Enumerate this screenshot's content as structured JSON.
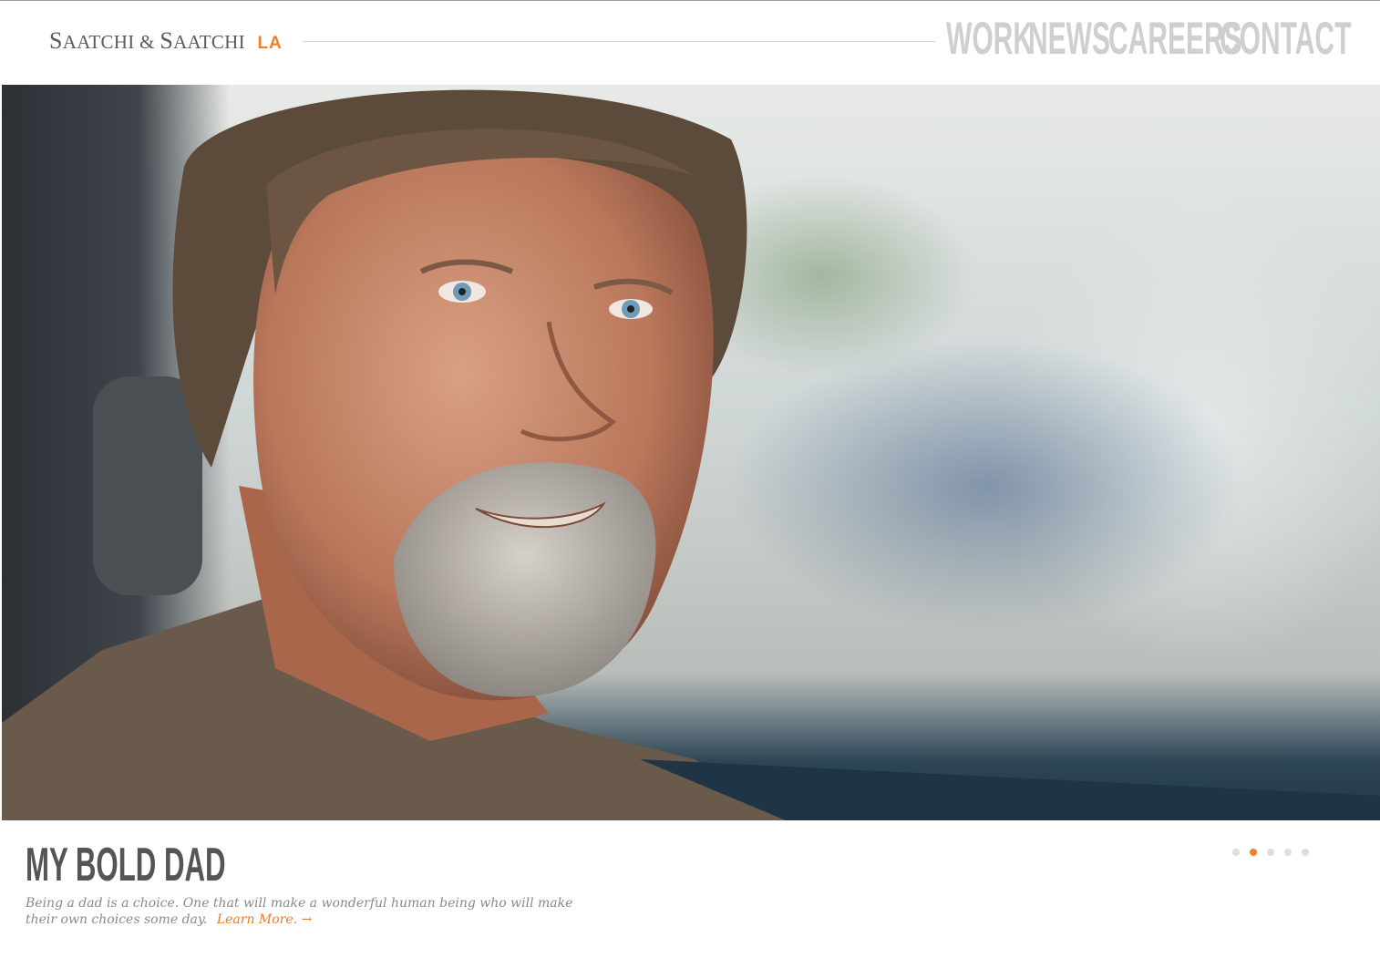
{
  "brand": {
    "name": "Saatchi & Saatchi",
    "name_caps_1": "S",
    "name_rest_1": "AATCHI",
    "name_amp": "&",
    "name_caps_2": "S",
    "name_rest_2": "AATCHI",
    "suffix": "LA",
    "accent_color": "#f07f2c"
  },
  "nav": {
    "items": [
      {
        "label": "WORK"
      },
      {
        "label": "NEWS"
      },
      {
        "label": "CAREERS"
      },
      {
        "label": "CONTACT"
      }
    ],
    "color": "#cfcfcf"
  },
  "hero": {
    "image_description_icon": "hero-photo"
  },
  "caption": {
    "title": "MY BOLD DAD",
    "body": "Being a dad is a choice. One that will make a wonderful human being who will make their own choices some day.",
    "learn_more": "Learn More. →"
  },
  "carousel": {
    "total": 5,
    "active_index": 1,
    "active_color": "#f07f2c",
    "inactive_color": "#dedede"
  }
}
